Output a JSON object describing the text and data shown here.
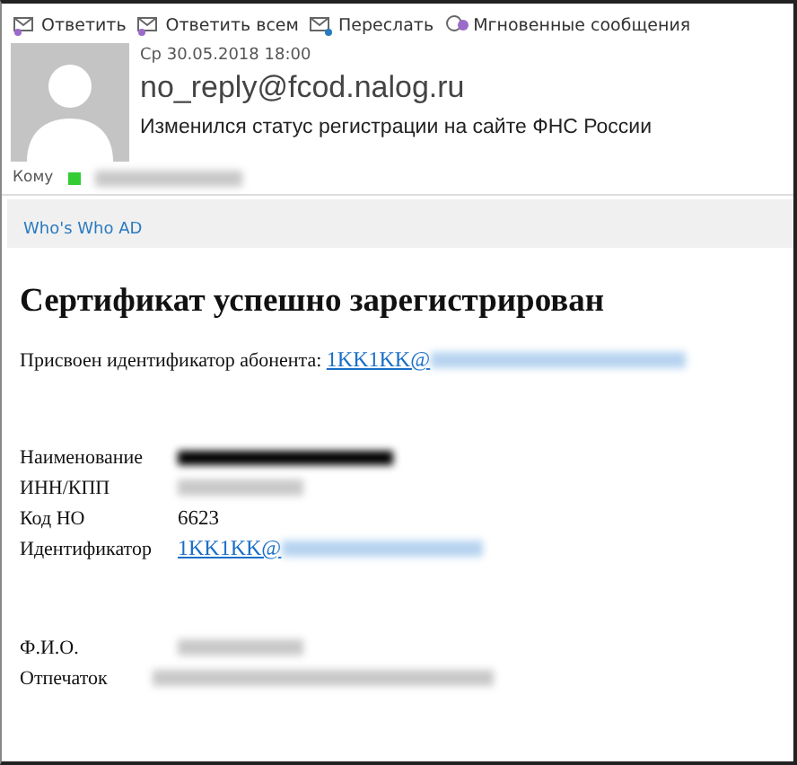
{
  "toolbar": [
    {
      "label": "Ответить",
      "kind": "reply"
    },
    {
      "label": "Ответить всем",
      "kind": "reply-all"
    },
    {
      "label": "Переслать",
      "kind": "forward"
    },
    {
      "label": "Мгновенные сообщения",
      "kind": "chat"
    }
  ],
  "message": {
    "date": "Ср 30.05.2018 18:00",
    "sender": "no_reply@fcod.nalog.ru",
    "subject": "Изменился статус регистрации на сайте ФНС России",
    "recipient": {
      "label": "Кому",
      "color": "#33cc33"
    }
  },
  "addin_bar": {
    "label": "Who's Who AD"
  },
  "body": {
    "heading": "Сертификат успешно зарегистрирован",
    "assigned": {
      "label": "Присвоен идентификатор абонента:",
      "link": "1KK1KK@"
    },
    "groups": [
      [
        {
          "label": "Наименование",
          "kind": "blacked"
        },
        {
          "label": "ИНН/КПП",
          "kind": "blurred"
        },
        {
          "label": "Код НО",
          "kind": "text",
          "value": "6623"
        },
        {
          "label": "Идентификатор",
          "kind": "link",
          "value": "1KK1KK@"
        }
      ],
      [
        {
          "label": "Ф.И.О.",
          "kind": "blurred"
        },
        {
          "label": "Отпечаток",
          "kind": "blurred-long"
        }
      ]
    ]
  }
}
